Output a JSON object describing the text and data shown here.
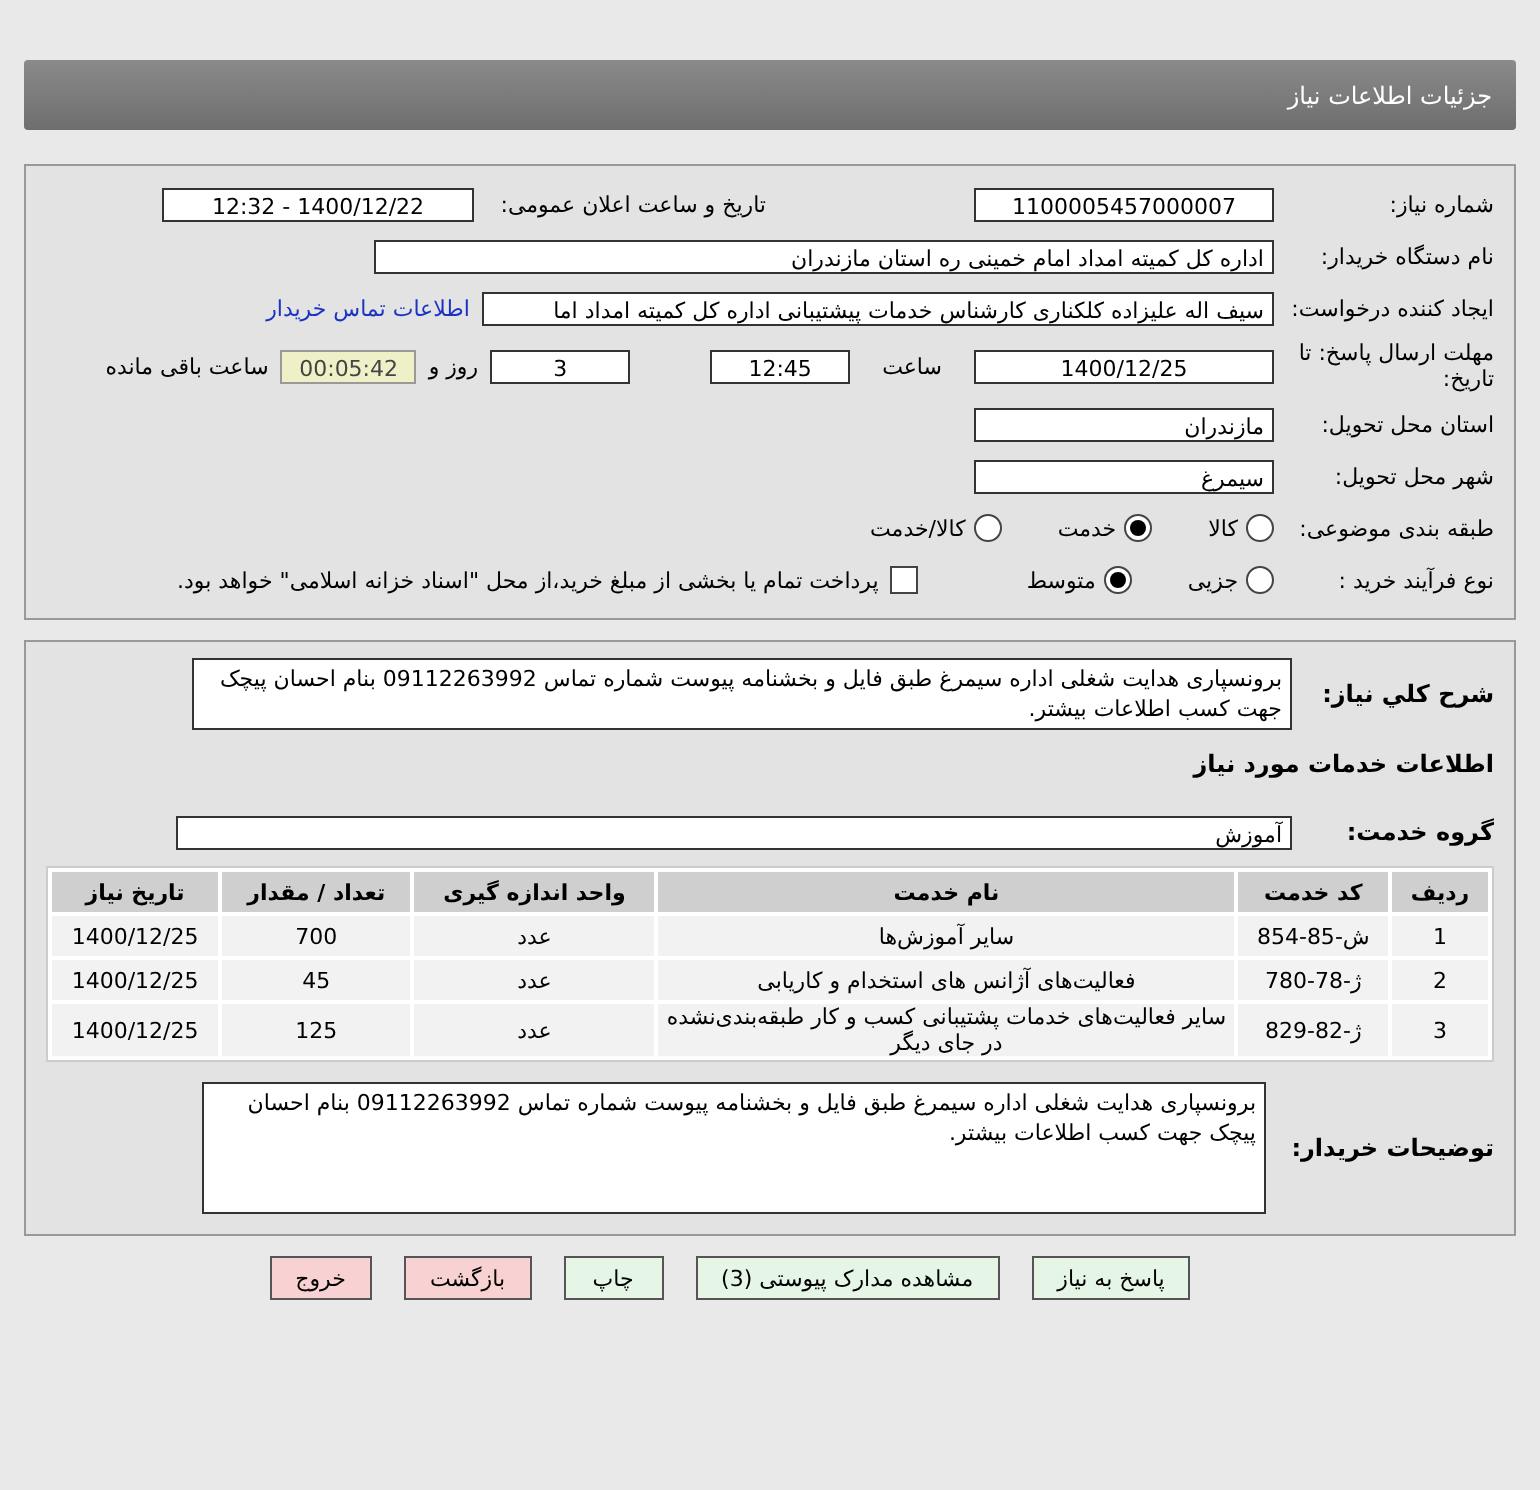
{
  "header": {
    "title": "جزئیات اطلاعات نیاز"
  },
  "need": {
    "need_number": {
      "label": "شماره نیاز:",
      "value": "1100005457000007"
    },
    "announce": {
      "label": "تاریخ و ساعت اعلان عمومی:",
      "value": "1400/12/22 - 12:32"
    },
    "buyer_org": {
      "label": "نام دستگاه خریدار:",
      "value": "اداره کل کمیته امداد امام خمینی  ره  استان مازندران"
    },
    "creator": {
      "label": "ایجاد کننده درخواست:",
      "value": "سیف اله علیزاده کلکناری کارشناس خدمات پیشتیبانی اداره کل کمیته امداد اما",
      "link": "اطلاعات تماس خریدار"
    },
    "deadline": {
      "label": "مهلت ارسال پاسخ: تا تاریخ:",
      "date": "1400/12/25",
      "time_label": "ساعت",
      "time": "12:45",
      "days": "3",
      "days_label": "روز و",
      "remaining": "00:05:42",
      "remaining_label": "ساعت باقی مانده"
    },
    "province": {
      "label": "استان محل تحویل:",
      "value": "مازندران"
    },
    "city": {
      "label": "شهر محل تحویل:",
      "value": "سیمرغ"
    },
    "category": {
      "label": "طبقه بندی موضوعی:",
      "options": [
        {
          "label": "کالا",
          "selected": false
        },
        {
          "label": "خدمت",
          "selected": true
        },
        {
          "label": "کالا/خدمت",
          "selected": false
        }
      ]
    },
    "purchase_type": {
      "label": "نوع فرآیند خرید :",
      "options": [
        {
          "label": "جزیی",
          "selected": false
        },
        {
          "label": "متوسط",
          "selected": true
        }
      ],
      "payment": {
        "checked": false,
        "text": "پرداخت تمام یا بخشی از مبلغ خرید،از محل \"اسناد خزانه اسلامی\" خواهد بود."
      }
    }
  },
  "details": {
    "description": {
      "label": "شرح کلي نياز:",
      "value": "برونسپاری هدایت شغلی اداره سیمرغ  طبق فایل و بخشنامه پیوست  شماره تماس 09112263992 بنام احسان پیچک  جهت کسب اطلاعات بیشتر."
    },
    "services_heading": "اطلاعات خدمات مورد نیاز",
    "service_group": {
      "label": "گروه خدمت:",
      "value": "آموزش"
    },
    "table": {
      "columns": [
        "ردیف",
        "کد خدمت",
        "نام خدمت",
        "واحد اندازه گیری",
        "تعداد / مقدار",
        "تاریخ نیاز"
      ],
      "rows": [
        [
          "1",
          "ش-85-854",
          "سایر آموزش‌ها",
          "عدد",
          "700",
          "1400/12/25"
        ],
        [
          "2",
          "ژ-78-780",
          "فعالیت‌های آژانس های استخدام و کاریابی",
          "عدد",
          "45",
          "1400/12/25"
        ],
        [
          "3",
          "ژ-82-829",
          "سایر فعالیت‌های خدمات پشتیبانی کسب و کار طبقه‌بندی‌نشده در جای دیگر",
          "عدد",
          "125",
          "1400/12/25"
        ]
      ]
    },
    "buyer_notes": {
      "label": "توضیحات خریدار:",
      "value": "برونسپاری هدایت شغلی اداره سیمرغ  طبق فایل و بخشنامه پیوست  شماره تماس 09112263992 بنام احسان پیچک  جهت کسب اطلاعات بیشتر."
    }
  },
  "buttons": [
    {
      "label": "پاسخ به نیاز",
      "kind": "normal"
    },
    {
      "label": "مشاهده مدارک پیوستی (3)",
      "kind": "normal"
    },
    {
      "label": "چاپ",
      "kind": "normal"
    },
    {
      "label": "بازگشت",
      "kind": "danger"
    },
    {
      "label": "خروج",
      "kind": "danger"
    }
  ]
}
